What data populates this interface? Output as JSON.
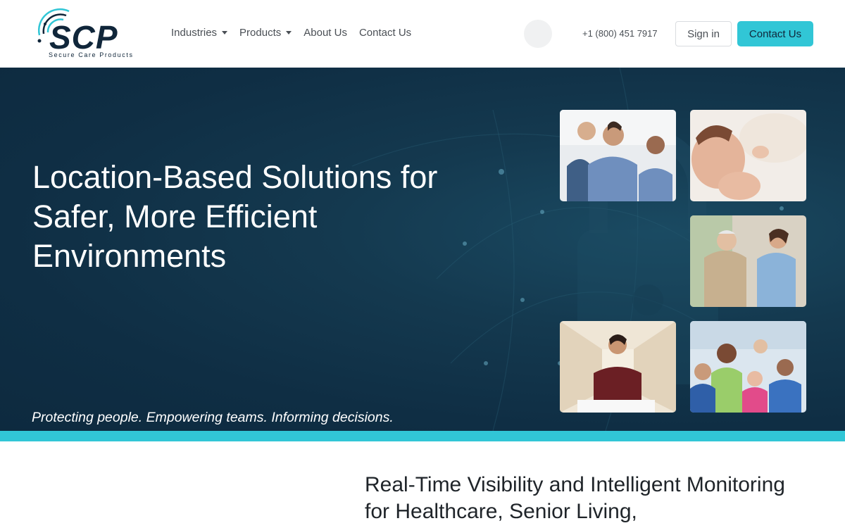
{
  "brand": {
    "logo_text": "SCP",
    "tagline": "Secure Care Products"
  },
  "nav": {
    "items": [
      {
        "label": "Industries",
        "dropdown": true
      },
      {
        "label": "Products",
        "dropdown": true
      },
      {
        "label": "About Us",
        "dropdown": false
      },
      {
        "label": "Contact Us",
        "dropdown": false
      }
    ],
    "phone": "+1 (800) 451 7917",
    "signin_label": "Sign in",
    "contact_label": "Contact Us"
  },
  "hero": {
    "title": "Location-Based Solutions for Safer, More Efficient Environments",
    "tagline": "Protecting people. Empowering teams. Informing decisions."
  },
  "section": {
    "title": "Real-Time Visibility and Intelligent Monitoring for Healthcare, Senior Living,"
  },
  "colors": {
    "accent": "#31c6d6",
    "navy": "#10263a",
    "hero_bg": "#0f2e44"
  }
}
